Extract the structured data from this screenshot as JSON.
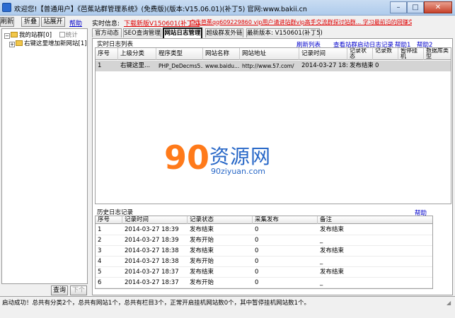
{
  "window": {
    "title": "欢迎您!【普通用户】《芭蕉站群管理系统》(免费版)(版本:V15.06.01)(补丁5) 官网:www.bakii.cn",
    "buttons": {
      "minimize": "–",
      "maximize": "□",
      "close": "✕"
    }
  },
  "toolbar": {
    "refresh": "刷新",
    "collapse": "折叠",
    "expand": "站展开",
    "help": "帮助",
    "realtime_label": "实时信息:",
    "download_link": "下载新版V150601(补丁5)",
    "qq_link": "点击芭蕉qq609229860 vip用户请讲站群vip高手交流群探讨站群... 学习最前沿的网赚交流"
  },
  "tree": {
    "root": "我的站群[0]",
    "stats": "统计",
    "child": "右键这里增加新网站[1]"
  },
  "tabs": [
    {
      "label": "官方动态"
    },
    {
      "label": "SEO查询管理"
    },
    {
      "label": "网站日志管理"
    },
    {
      "label": "超级群发外链"
    },
    {
      "label": "最新版本: V150601(补丁5)"
    }
  ],
  "realtime": {
    "section_label": "实时日志列表",
    "links": {
      "refresh": "刷新列表",
      "view_history": "查看站群启动日志记录",
      "help1": "帮助1",
      "help2": "帮助2"
    },
    "columns": [
      "序号",
      "上级分类",
      "程序类型",
      "网站名称",
      "网站地址",
      "记录时间",
      "记录状态",
      "记录数",
      "暂停挂机",
      "数据库类型"
    ],
    "rows": [
      [
        "1",
        "右键这里...",
        "PHP_DeDecms5...",
        "www.baidu...",
        "http://www.57.com/",
        "2014-03-27 18:39",
        "发布结束",
        "0",
        "",
        ""
      ]
    ]
  },
  "history": {
    "section_label": "历史日志记录",
    "help": "帮助",
    "columns": [
      "序号",
      "记录时间",
      "记录状态",
      "采集发布",
      "备注"
    ],
    "rows": [
      [
        "1",
        "2014-03-27 18:39",
        "发布结束",
        "0",
        "发布结束"
      ],
      [
        "2",
        "2014-03-27 18:39",
        "发布开始",
        "0",
        "_"
      ],
      [
        "3",
        "2014-03-27 18:38",
        "发布结束",
        "0",
        "发布结束"
      ],
      [
        "4",
        "2014-03-27 18:38",
        "发布开始",
        "0",
        "_"
      ],
      [
        "5",
        "2014-03-27 18:37",
        "发布结束",
        "0",
        "发布结束"
      ],
      [
        "6",
        "2014-03-27 18:37",
        "发布开始",
        "0",
        "_"
      ]
    ]
  },
  "watermark": {
    "logo": "90",
    "text": "资源网",
    "url": "90ziyuan.com"
  },
  "bottom": {
    "query": "查询",
    "next": "下个"
  },
  "status": {
    "text": "启动成功！总共有分类2个，总共有网站1个，总共有栏目3个，正常开启挂机网站数0个，其中暂停挂机网站数1个。"
  }
}
